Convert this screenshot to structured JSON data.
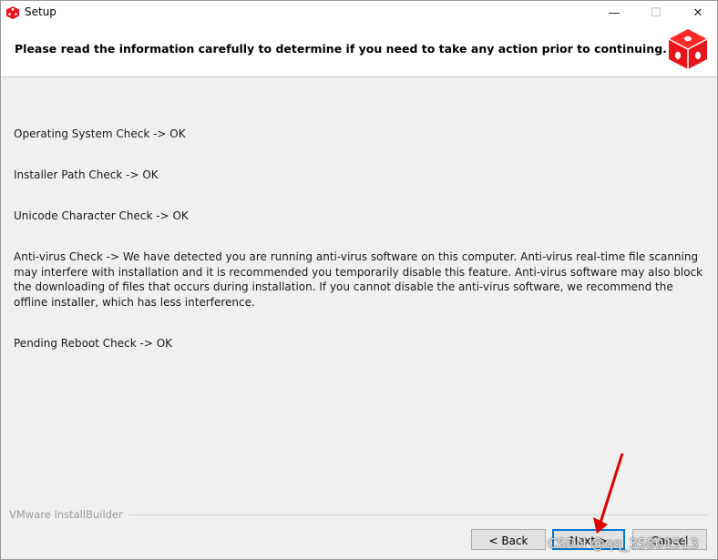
{
  "window": {
    "title": "Setup",
    "controls": {
      "minimize": "—",
      "maximize": "☐",
      "close": "✕"
    }
  },
  "header": {
    "heading": "Please read the information carefully to determine if you need to take any action prior to continuing."
  },
  "checks": [
    "Operating System Check -> OK",
    "Installer Path Check -> OK",
    "Unicode Character Check ->  OK",
    "Anti-virus Check -> We have detected you are running anti-virus software on this computer. Anti-virus real-time file scanning may interfere with installation and it is recommended you temporarily disable this feature. Anti-virus software may also block the downloading of files that occurs during installation. If you cannot disable the anti-virus software, we recommend the offline installer, which has less interference.",
    "Pending Reboot Check -> OK"
  ],
  "footer": {
    "brand": "VMware InstallBuilder",
    "buttons": {
      "back": "< Back",
      "next": "Next >",
      "cancel": "Cancel"
    }
  },
  "watermark": "CSDN @qq_35801513",
  "colors": {
    "accent": "#e8141b",
    "annotation_arrow": "#e00000",
    "focus_border": "#0078d7"
  }
}
